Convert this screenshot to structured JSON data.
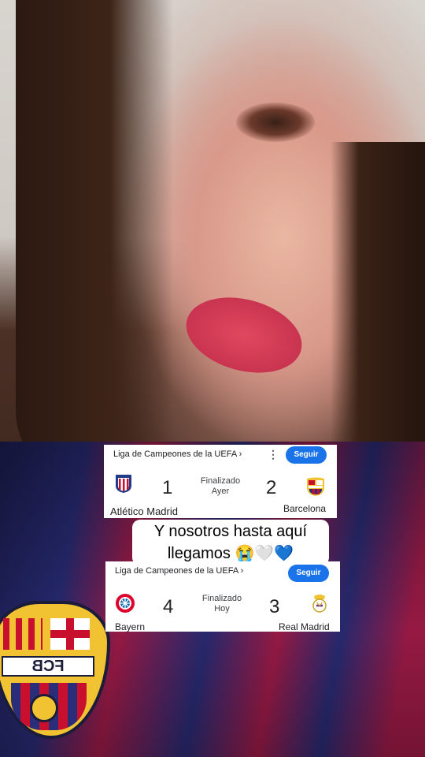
{
  "caption": {
    "line1": "Y nosotros hasta aquí",
    "line2": "llegamos 😭🤍💙"
  },
  "matches": [
    {
      "competition": "Liga de Campeones de la UEFA ›",
      "menu_icon": "⋮",
      "follow_label": "Seguir",
      "home_team": "Atlético Madrid",
      "home_score": "1",
      "away_team": "Barcelona",
      "away_score": "2",
      "status_line1": "Finalizado",
      "status_line2": "Ayer"
    },
    {
      "competition": "Liga de Campeones de la UEFA ›",
      "follow_label": "Seguir",
      "home_team": "Bayern",
      "home_score": "4",
      "away_team": "Real Madrid",
      "away_score": "3",
      "status_line1": "Finalizado",
      "status_line2": "Hoy"
    }
  ],
  "jersey_text": "FCB",
  "colors": {
    "follow_button": "#1a73e8",
    "barca_blue": "#2a2d7a",
    "barca_red": "#a61c4b"
  }
}
